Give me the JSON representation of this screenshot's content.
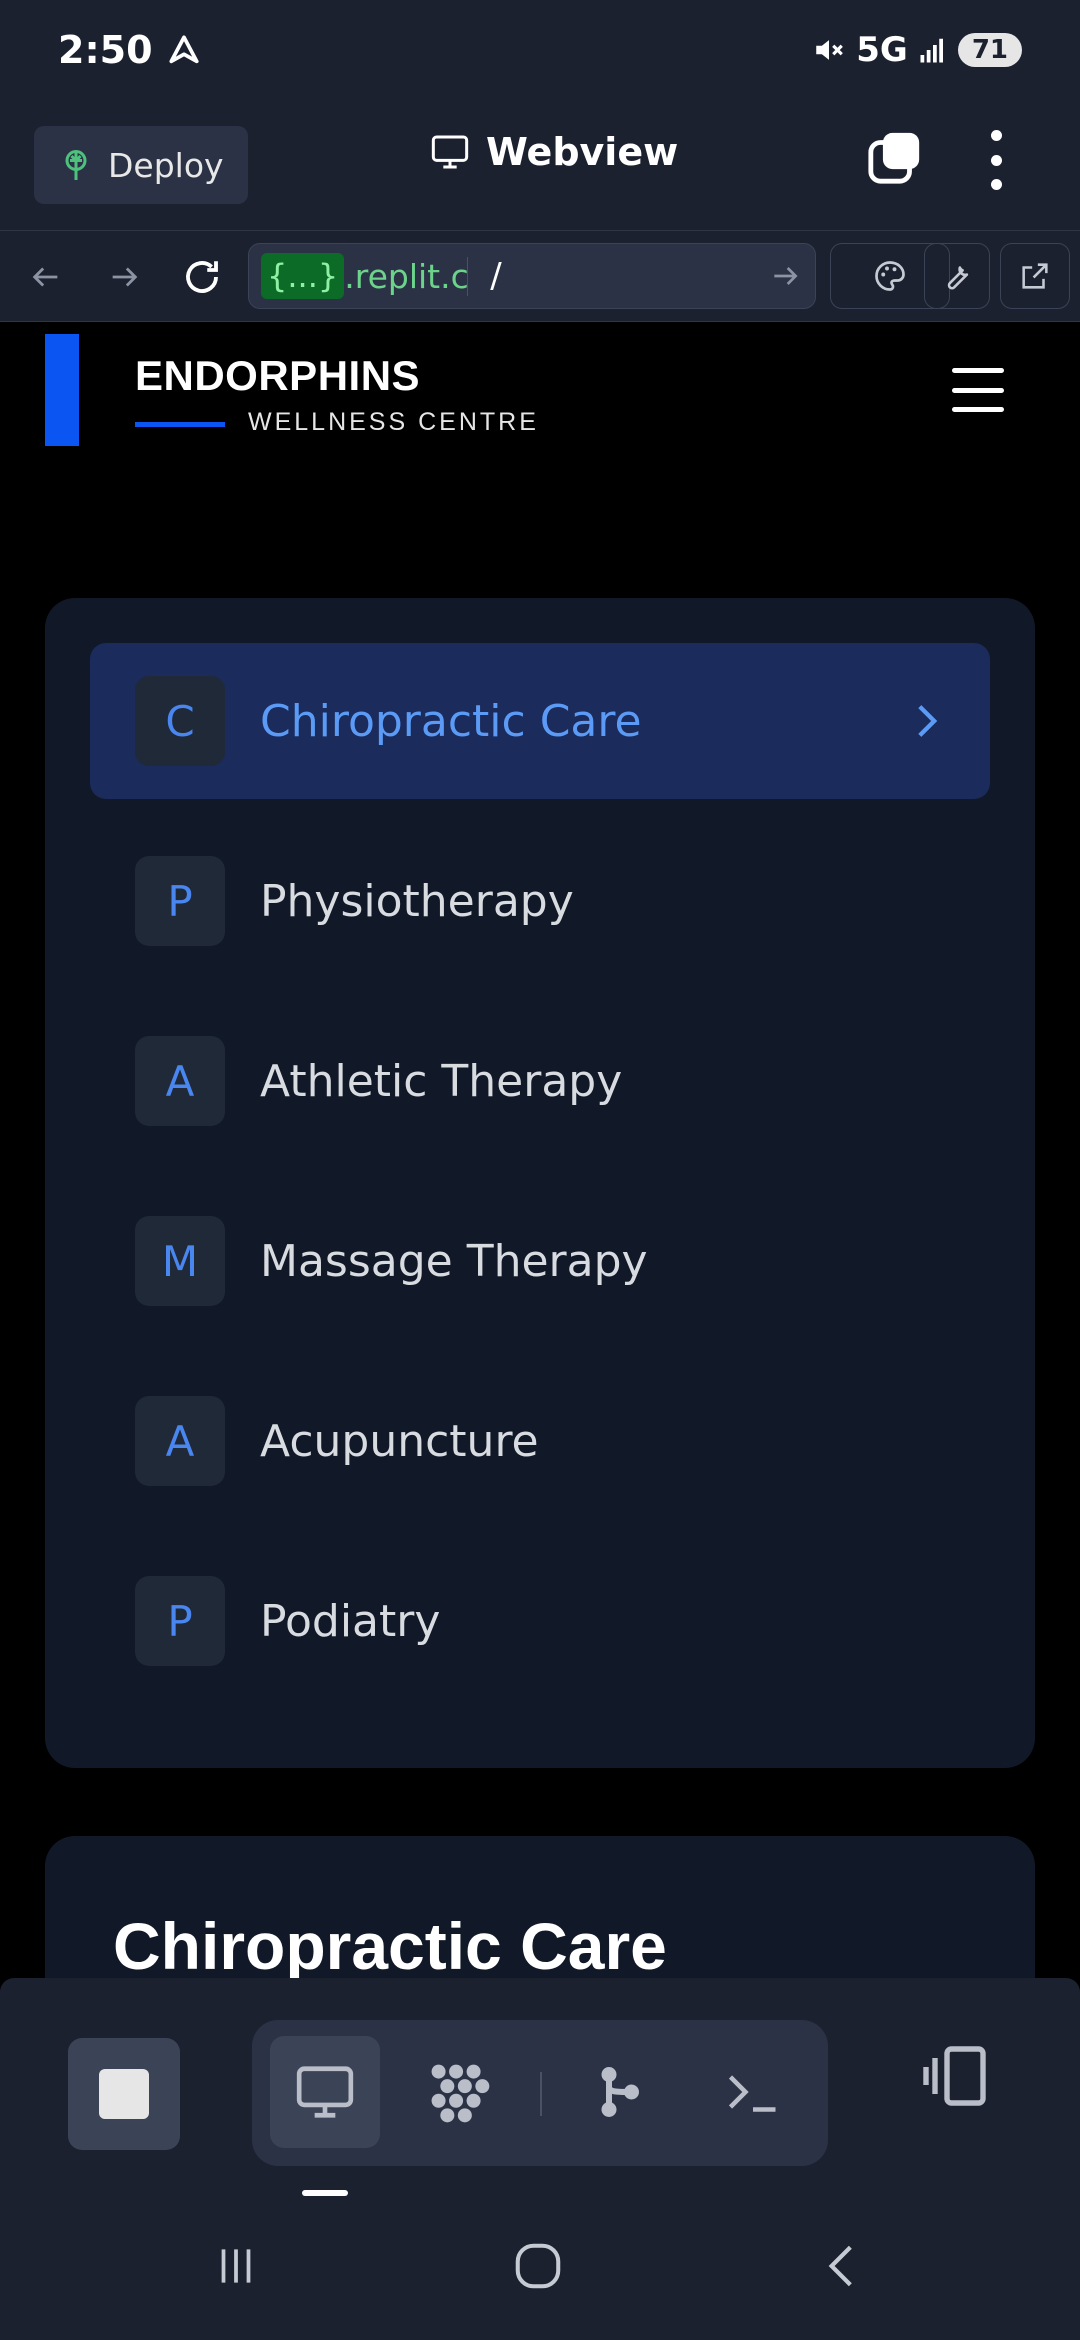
{
  "status_bar": {
    "time": "2:50",
    "network": "5G",
    "battery": "71"
  },
  "header": {
    "deploy_label": "Deploy",
    "webview_label": "Webview"
  },
  "url_bar": {
    "badge": "{...}",
    "domain": ".replit.c",
    "path": "/"
  },
  "site": {
    "logo_title": "ENDORPHINS",
    "logo_subtitle": "WELLNESS CENTRE",
    "services": [
      {
        "letter": "C",
        "label": "Chiropractic Care",
        "active": true
      },
      {
        "letter": "P",
        "label": "Physiotherapy"
      },
      {
        "letter": "A",
        "label": "Athletic Therapy"
      },
      {
        "letter": "M",
        "label": "Massage Therapy"
      },
      {
        "letter": "A",
        "label": "Acupuncture"
      },
      {
        "letter": "P",
        "label": "Podiatry"
      }
    ],
    "detail_title": "Chiropractic Care"
  },
  "colors": {
    "accent_blue": "#0b55f2",
    "active_item_bg": "#1a2b5c",
    "active_text": "#5b9af5",
    "card_bg": "#111827",
    "replit_bar": "#1c2130"
  },
  "icons": [
    "navigation-arrow-icon",
    "mute-icon",
    "signal-icon",
    "deploy-icon",
    "monitor-icon",
    "tabs-icon",
    "more-icon",
    "back-icon",
    "forward-icon",
    "reload-icon",
    "go-icon",
    "palette-icon",
    "wrench-icon",
    "external-link-icon",
    "hamburger-icon",
    "chevron-right-icon",
    "stop-icon",
    "workflow-icon",
    "git-icon",
    "shell-icon",
    "layout-icon",
    "recents-icon",
    "home-icon",
    "nav-back-icon"
  ]
}
